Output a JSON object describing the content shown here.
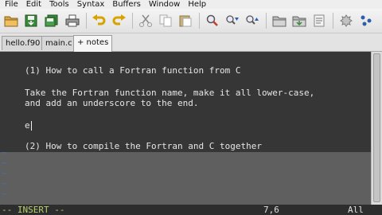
{
  "menu": [
    "File",
    "Edit",
    "Tools",
    "Syntax",
    "Buffers",
    "Window",
    "Help"
  ],
  "toolbar": {
    "colors": {
      "folder": "#d9a441",
      "save": "#3a8a3a",
      "undo": "#d6a300",
      "find": "#c43c2a",
      "arrows": "#2c5fa8"
    },
    "icons": [
      "open-icon",
      "save-icon",
      "save-all-icon",
      "print-icon",
      "undo-icon",
      "redo-icon",
      "cut-icon",
      "copy-icon",
      "paste-icon",
      "find-replace-icon",
      "find-next-icon",
      "find-prev-icon",
      "load-session-icon",
      "save-session-icon",
      "run-script-icon",
      "make-icon",
      "tags-icon",
      "help-icon"
    ]
  },
  "tabs": [
    {
      "label": "hello.f90",
      "active": false
    },
    {
      "label": "main.c",
      "active": false
    },
    {
      "label": "+ notes",
      "active": true
    }
  ],
  "editor": {
    "lines": [
      "(1) How to call a Fortran function from C",
      "",
      "Take the Fortran function name, make it all lower-case,",
      "and add an underscore to the end.",
      "",
      "e",
      "",
      "(2) How to compile the Fortran and C together"
    ],
    "tilde_lines": [
      "~",
      "~",
      "~",
      "~",
      "~"
    ],
    "colors": {
      "text_background": "#363636",
      "filler_background": "#5f5f5f",
      "tilde": "#4a6db4"
    }
  },
  "status": {
    "mode": "-- INSERT --",
    "position": "7,6",
    "scroll": "All"
  }
}
